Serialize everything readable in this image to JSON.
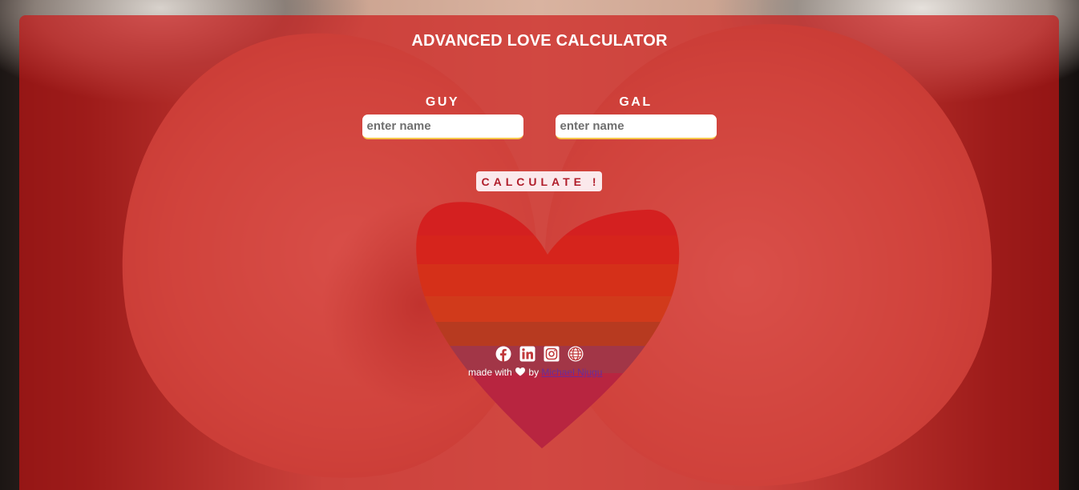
{
  "app": {
    "title": "ADVANCED LOVE CALCULATOR"
  },
  "form": {
    "guy": {
      "label": "GUY",
      "placeholder": "enter name",
      "value": ""
    },
    "gal": {
      "label": "GAL",
      "placeholder": "enter name",
      "value": ""
    },
    "calculate_label": "CALCULATE !"
  },
  "footer": {
    "social_icons": [
      "facebook-icon",
      "linkedin-icon",
      "instagram-icon",
      "globe-icon"
    ],
    "made_with": "made with",
    "by": "by",
    "author": "Michael Njugu"
  },
  "colors": {
    "overlay": "#cd1414",
    "button_text": "#b01d2a",
    "button_bg": "#fbe9ec",
    "input_underline": "#f6c64b",
    "author_link": "#6b2b9a"
  }
}
